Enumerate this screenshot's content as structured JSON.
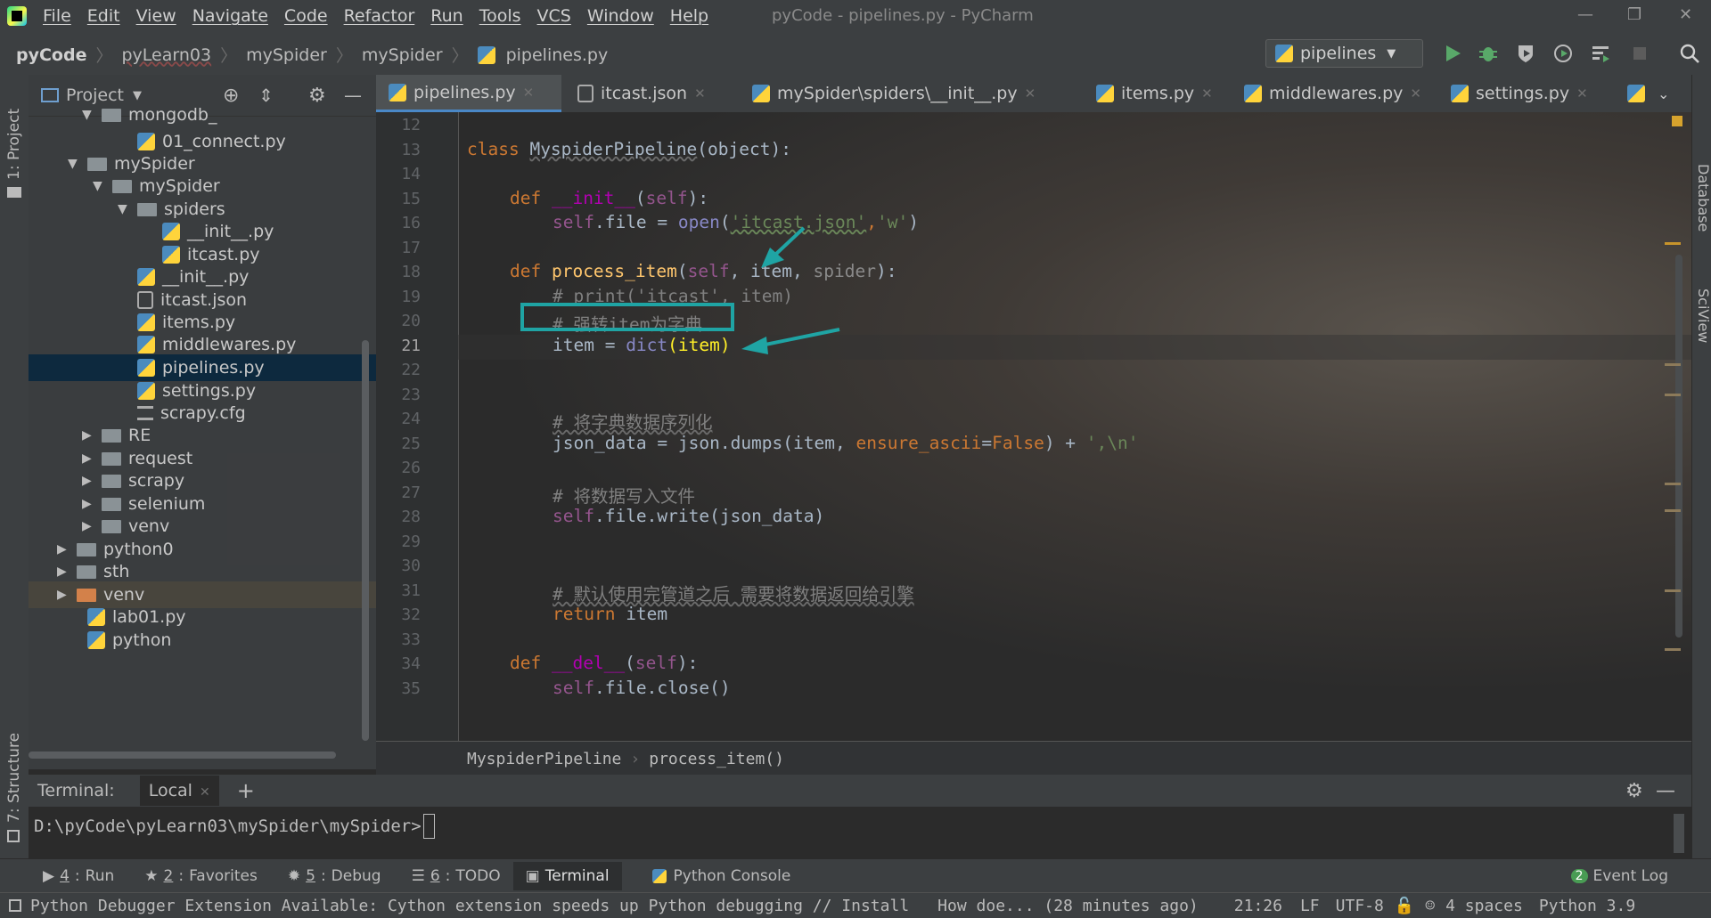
{
  "window": {
    "title": "pyCode - pipelines.py - PyCharm"
  },
  "menu": [
    "File",
    "Edit",
    "View",
    "Navigate",
    "Code",
    "Refactor",
    "Run",
    "Tools",
    "VCS",
    "Window",
    "Help"
  ],
  "breadcrumb": [
    "pyCode",
    "pyLearn03",
    "mySpider",
    "mySpider",
    "pipelines.py"
  ],
  "run_config": "pipelines",
  "left_stripe": {
    "project": "1: Project",
    "structure": "7: Structure"
  },
  "right_stripe": {
    "database": "Database",
    "sciview": "SciView"
  },
  "project_panel": {
    "title": "Project",
    "tree": [
      {
        "label": "mongodb_",
        "type": "folder"
      },
      {
        "label": "01_connect.py",
        "type": "py"
      },
      {
        "label": "mySpider",
        "type": "folder"
      },
      {
        "label": "mySpider",
        "type": "folder"
      },
      {
        "label": "spiders",
        "type": "folder"
      },
      {
        "label": "__init__.py",
        "type": "py"
      },
      {
        "label": "itcast.py",
        "type": "py"
      },
      {
        "label": "__init__.py",
        "type": "py"
      },
      {
        "label": "itcast.json",
        "type": "json"
      },
      {
        "label": "items.py",
        "type": "py"
      },
      {
        "label": "middlewares.py",
        "type": "py"
      },
      {
        "label": "pipelines.py",
        "type": "py"
      },
      {
        "label": "settings.py",
        "type": "py"
      },
      {
        "label": "scrapy.cfg",
        "type": "cfg"
      },
      {
        "label": "RE",
        "type": "folder"
      },
      {
        "label": "request",
        "type": "folder"
      },
      {
        "label": "scrapy",
        "type": "folder"
      },
      {
        "label": "selenium",
        "type": "folder"
      },
      {
        "label": "venv",
        "type": "folder"
      },
      {
        "label": "python0",
        "type": "folder"
      },
      {
        "label": "sth",
        "type": "folder"
      },
      {
        "label": "venv",
        "type": "folder"
      },
      {
        "label": "lab01.py",
        "type": "py"
      },
      {
        "label": "python",
        "type": "py"
      }
    ]
  },
  "tabs": [
    "pipelines.py",
    "itcast.json",
    "mySpider\\spiders\\__init__.py",
    "items.py",
    "middlewares.py",
    "settings.py"
  ],
  "line_numbers": [
    "12",
    "13",
    "14",
    "15",
    "16",
    "17",
    "18",
    "19",
    "20",
    "21",
    "22",
    "23",
    "24",
    "25",
    "26",
    "27",
    "28",
    "29",
    "30",
    "31",
    "32",
    "33",
    "34",
    "35"
  ],
  "code": {
    "l13": [
      "class ",
      "MyspiderPipeline",
      "(object):"
    ],
    "l15": [
      "def ",
      "__init__",
      "(",
      "self",
      "):"
    ],
    "l16": [
      "self",
      ".file = ",
      "open",
      "(",
      "'itcast.json'",
      ",",
      "'w'",
      ")"
    ],
    "l18": [
      "def ",
      "process_item",
      "(",
      "self",
      ", item, ",
      "spider",
      "):"
    ],
    "l19": "# print('itcast', item)",
    "l20": "# 强转item为字典",
    "l21": [
      "item = ",
      "dict",
      "(item)"
    ],
    "l24": "# 将字典数据序列化",
    "l25": [
      "json_data = json.dumps(item, ",
      "ensure_ascii",
      "=",
      "False",
      ") + ",
      "',\\n'"
    ],
    "l27": "# 将数据写入文件",
    "l28": [
      "self",
      ".file.write(json_data)"
    ],
    "l31": "# 默认使用完管道之后 需要将数据返回给引擎",
    "l32": [
      "return ",
      "item"
    ],
    "l34": [
      "def ",
      "__del__",
      "(",
      "self",
      "):"
    ],
    "l35": [
      "self",
      ".file.close()"
    ]
  },
  "editor_breadcrumb": [
    "MyspiderPipeline",
    "process_item()"
  ],
  "terminal": {
    "label": "Terminal:",
    "tab": "Local",
    "prompt": "D:\\pyCode\\pyLearn03\\mySpider\\mySpider>"
  },
  "tool_windows": [
    {
      "num": "4",
      "label": "Run"
    },
    {
      "num": "2",
      "label": "Favorites"
    },
    {
      "num": "5",
      "label": "Debug"
    },
    {
      "num": "6",
      "label": "TODO"
    },
    {
      "num": "",
      "label": "Terminal"
    },
    {
      "num": "",
      "label": "Python Console"
    }
  ],
  "event_log": {
    "count": "2",
    "label": "Event Log"
  },
  "status": {
    "message": "Python Debugger Extension Available: Cython extension speeds up Python debugging // Install",
    "message2": "How doe... (28 minutes ago)",
    "position": "21:26",
    "line_sep": "LF",
    "encoding": "UTF-8",
    "indent": "4 spaces",
    "interpreter": "Python 3.9"
  },
  "colors": {
    "accent": "#4a88c7",
    "annotation": "#1fa4a4",
    "keyword": "#cc7832",
    "string": "#6a8759"
  }
}
